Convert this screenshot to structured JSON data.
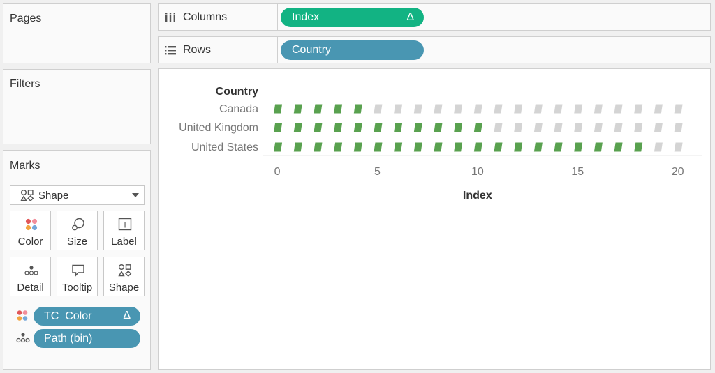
{
  "panels": {
    "pages": "Pages",
    "filters": "Filters",
    "marks": "Marks"
  },
  "marks_card": {
    "mark_type": "Shape",
    "buttons": [
      "Color",
      "Size",
      "Label",
      "Detail",
      "Tooltip",
      "Shape"
    ],
    "fields": [
      {
        "label": "TC_Color",
        "delta": "Δ",
        "encoding": "color"
      },
      {
        "label": "Path (bin)",
        "delta": "",
        "encoding": "detail"
      }
    ]
  },
  "shelves": {
    "columns": {
      "label": "Columns",
      "pill": "Index",
      "delta": "Δ",
      "pill_color": "#12b383"
    },
    "rows": {
      "label": "Rows",
      "pill": "Country",
      "pill_color": "#4996b2"
    }
  },
  "chart_data": {
    "type": "scatter",
    "row_header": "Country",
    "categories": [
      "Canada",
      "United Kingdom",
      "United States"
    ],
    "x": [
      0,
      1,
      2,
      3,
      4,
      5,
      6,
      7,
      8,
      9,
      10,
      11,
      12,
      13,
      14,
      15,
      16,
      17,
      18,
      19,
      20
    ],
    "filled_through": [
      4,
      10,
      18
    ],
    "filled_color": "#59a14f",
    "empty_color": "#d4d4d4",
    "xlabel": "Index",
    "xticks": [
      0,
      5,
      10,
      15,
      20
    ],
    "xlim": [
      -0.7,
      21.2
    ]
  }
}
